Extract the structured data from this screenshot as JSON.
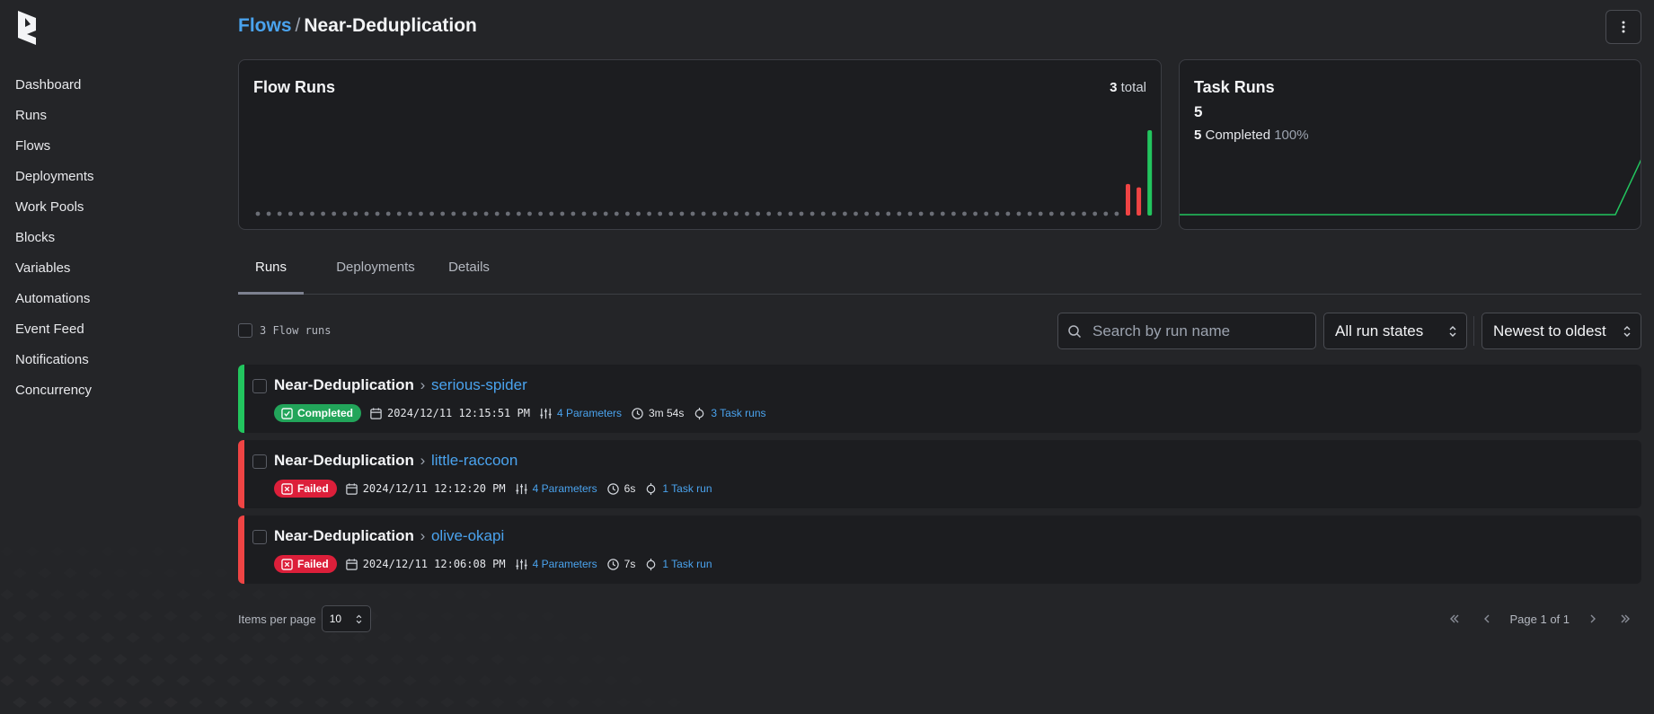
{
  "nav": {
    "items": [
      "Dashboard",
      "Runs",
      "Flows",
      "Deployments",
      "Work Pools",
      "Blocks",
      "Variables",
      "Automations",
      "Event Feed",
      "Notifications",
      "Concurrency"
    ]
  },
  "breadcrumb": {
    "parent": "Flows",
    "separator": "/",
    "current": "Near-Deduplication"
  },
  "flow_runs_card": {
    "title": "Flow Runs",
    "total_count": "3",
    "total_suffix": " total",
    "bars": [
      {
        "state": "Failed",
        "color": "#ef4444",
        "relative_height": 0.37
      },
      {
        "state": "Failed",
        "color": "#ef4444",
        "relative_height": 0.33
      },
      {
        "state": "Completed",
        "color": "#22c55e",
        "relative_height": 1.0
      }
    ]
  },
  "task_runs_card": {
    "title": "Task Runs",
    "count": "5",
    "completed_count": "5",
    "completed_label": " Completed ",
    "completed_pct": "100%",
    "line_color": "#22c55e"
  },
  "tabs": {
    "runs": "Runs",
    "deployments": "Deployments",
    "details": "Details"
  },
  "toolbar": {
    "count_label": "3 Flow runs",
    "search_placeholder": "Search by run name",
    "state_filter": "All run states",
    "sort": "Newest to oldest"
  },
  "runs": [
    {
      "flow": "Near-Deduplication",
      "name": "serious-spider",
      "state": "Completed",
      "state_color": "#22a55a",
      "stripe_color": "#22c55e",
      "timestamp": "2024/12/11 12:15:51 PM",
      "parameters": "4 Parameters",
      "duration": "3m 54s",
      "task_runs": "3 Task runs"
    },
    {
      "flow": "Near-Deduplication",
      "name": "little-raccoon",
      "state": "Failed",
      "state_color": "#dc1f3a",
      "stripe_color": "#ef4444",
      "timestamp": "2024/12/11 12:12:20 PM",
      "parameters": "4 Parameters",
      "duration": "6s",
      "task_runs": "1 Task run"
    },
    {
      "flow": "Near-Deduplication",
      "name": "olive-okapi",
      "state": "Failed",
      "state_color": "#dc1f3a",
      "stripe_color": "#ef4444",
      "timestamp": "2024/12/11 12:06:08 PM",
      "parameters": "4 Parameters",
      "duration": "7s",
      "task_runs": "1 Task run"
    }
  ],
  "pagination": {
    "items_per_page_label": "Items per page",
    "items_per_page": "10",
    "page_label": "Page 1 of 1"
  },
  "colors": {
    "accent": "#4aa3ee",
    "completed": "#22c55e",
    "failed": "#ef4444"
  },
  "icons": [
    "prefect-logo-icon",
    "more-vertical-icon",
    "search-icon",
    "chevron-up-down-icon",
    "calendar-icon",
    "parameters-icon",
    "clock-icon",
    "task-run-icon",
    "check-square-icon",
    "x-square-icon",
    "chevrons-left-icon",
    "chevron-left-icon",
    "chevron-right-icon",
    "chevrons-right-icon"
  ]
}
